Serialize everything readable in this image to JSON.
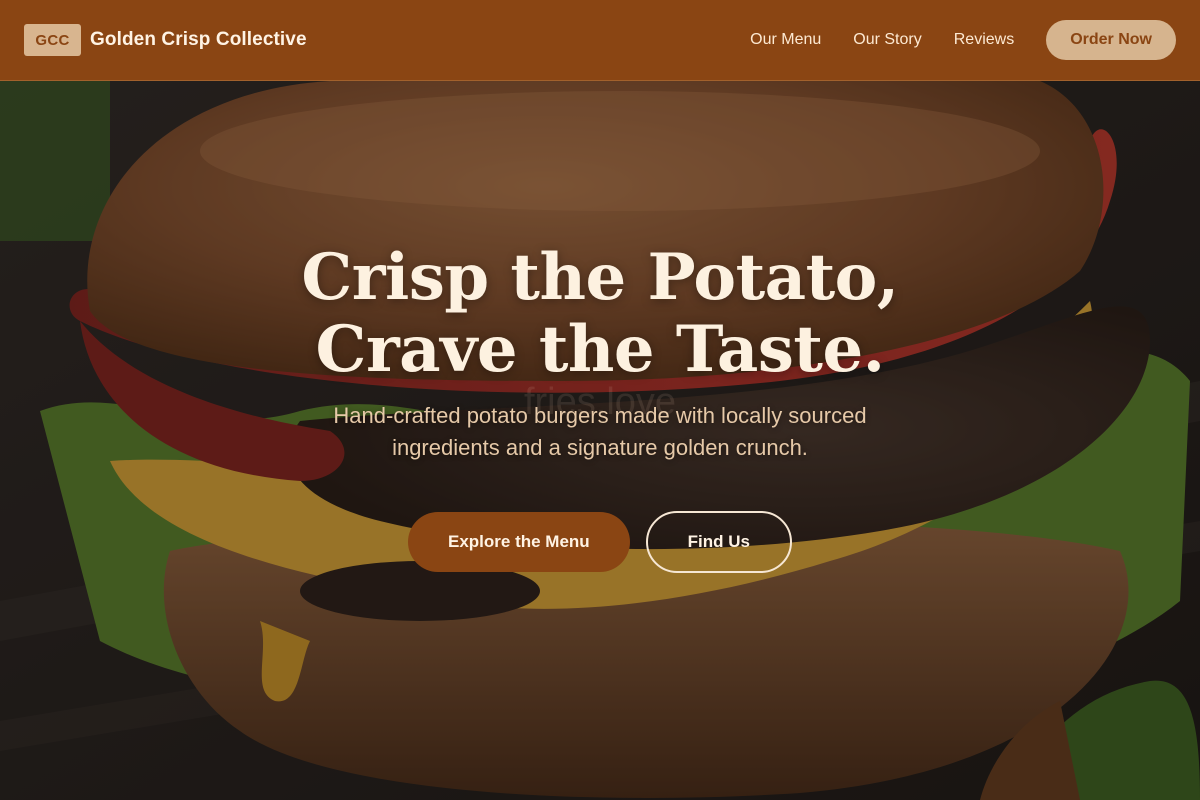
{
  "header": {
    "logo_badge": "GCC",
    "brand_name": "Golden Crisp Collective",
    "nav": [
      {
        "label": "Our Menu"
      },
      {
        "label": "Our Story"
      },
      {
        "label": "Reviews"
      }
    ],
    "order_button": "Order Now"
  },
  "hero": {
    "headline_line1": "Crisp the Potato,",
    "headline_line2": "Crave the Taste.",
    "watermark": "fries.love",
    "subhead": "Hand-crafted potato burgers made with locally sourced ingredients and a signature golden crunch.",
    "primary_cta": "Explore the Menu",
    "secondary_cta": "Find Us",
    "background_image": "burger-photo"
  },
  "colors": {
    "brand": "#8a4513",
    "accent": "#d6b48e",
    "headline": "#fdf1e0",
    "subhead": "#e6c9a8"
  }
}
